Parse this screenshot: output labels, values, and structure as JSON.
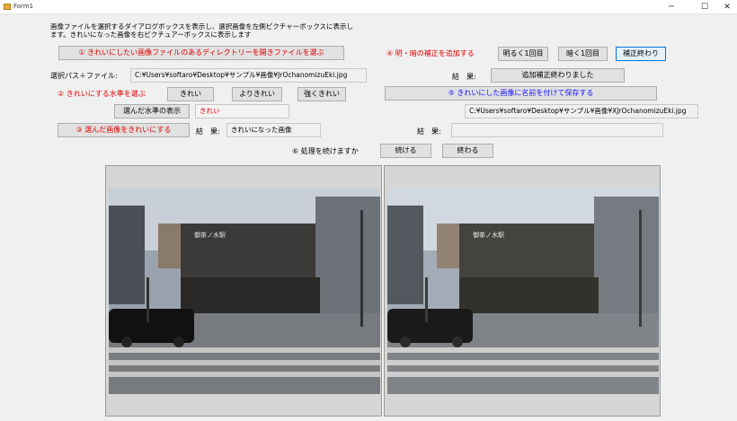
{
  "window": {
    "title": "Form1",
    "minimize": "─",
    "maximize": "☐",
    "close": "✕"
  },
  "description": "画像ファイルを選択するダイアログボックスを表示し、選択画像を左側ピクチャーボックスに表示します。きれいになった画像を右ピクチュアーボックスに表示します",
  "step1": {
    "button": "① きれいにしたい画像ファイルのあるディレクトリーを開きファイルを選ぶ"
  },
  "path": {
    "label": "選択パス＋ファイル:",
    "value": "C:¥Users¥softaro¥Desktop¥サンプル¥画像¥JrOchanomizuEki.jpg"
  },
  "step2": {
    "label": "② きれいにする水準を選ぶ",
    "levels": [
      "きれい",
      "よりきれい",
      "強くきれい"
    ],
    "show_button": "選んだ水準の表示",
    "selected": "きれい"
  },
  "step3": {
    "button": "③ 選んだ画像をきれいにする",
    "result_label": "結　果:",
    "result": "きれいになった画像"
  },
  "step4": {
    "label": "④ 明・暗の補正を追加する",
    "brighter": "明るく1回目",
    "darker": "暗く1回目",
    "finish": "補正終わり",
    "result_label": "結　果:",
    "result": "追加補正終わりました"
  },
  "step5": {
    "button": "⑤ きれいにした画像に名前を付けて保存する",
    "path": "C:¥Users¥softaro¥Desktop¥サンプル¥画像¥XJrOchanomizuEki.jpg",
    "result_label": "結　果:",
    "result": ""
  },
  "step6": {
    "label": "⑥ 処理を続けますか",
    "continue": "続ける",
    "end": "終わる"
  },
  "photo": {
    "sign": "御茶ノ水駅"
  }
}
